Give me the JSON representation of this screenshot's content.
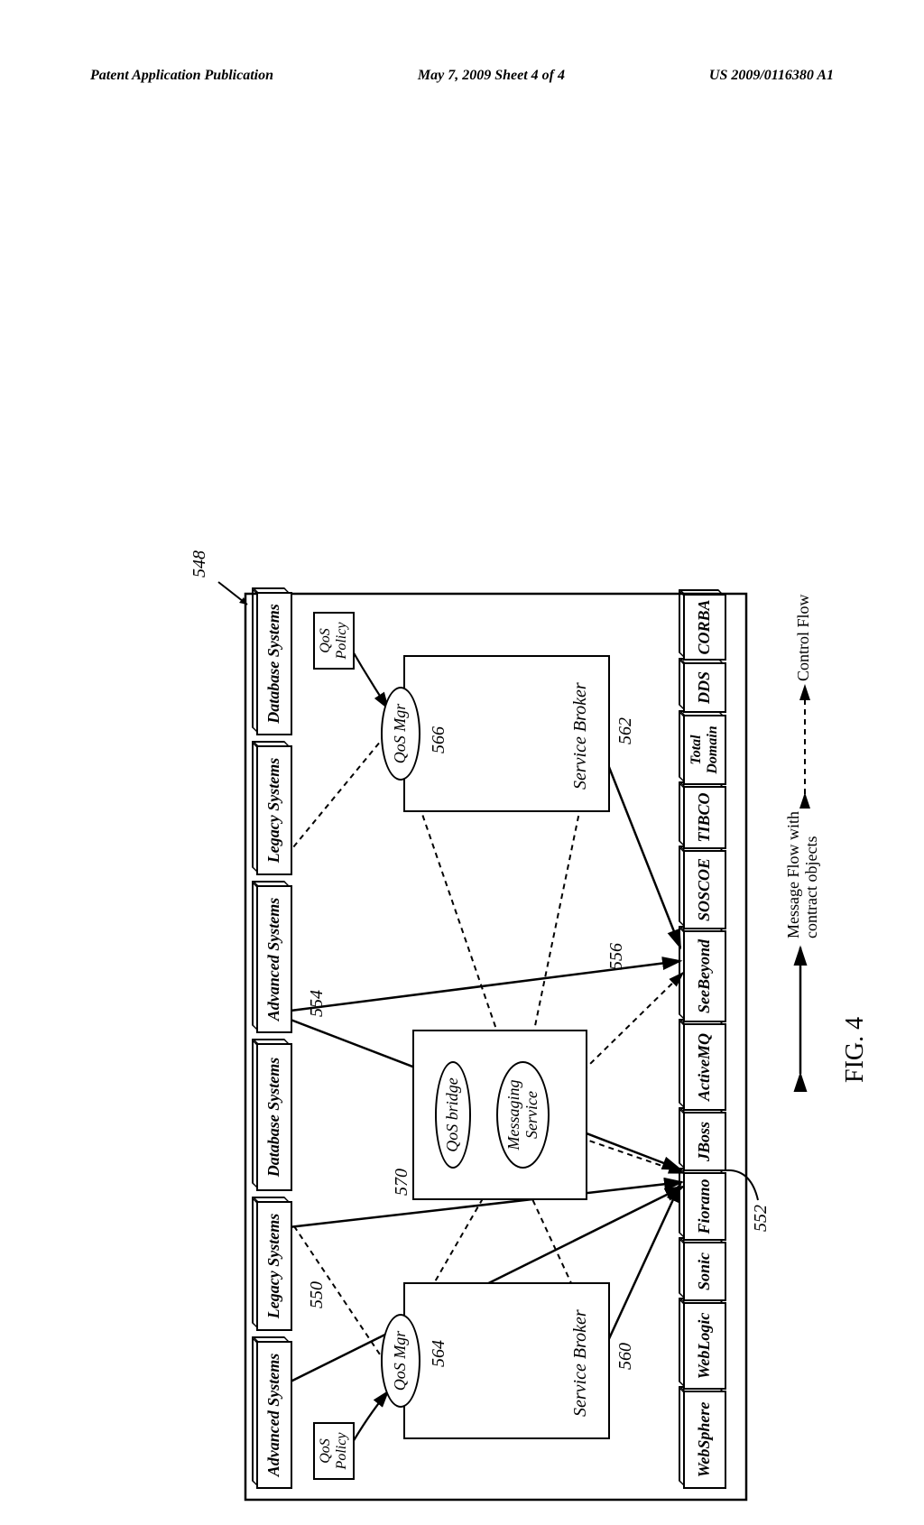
{
  "header": {
    "left": "Patent Application Publication",
    "center": "May 7, 2009   Sheet 4 of 4",
    "right": "US 2009/0116380 A1"
  },
  "figure": {
    "label": "FIG. 4",
    "mainRef": "548"
  },
  "topBoxes": {
    "adv1": "Advanced Systems",
    "leg1": "Legacy Systems",
    "db1": "Database Systems",
    "adv2": "Advanced Systems",
    "leg2": "Legacy Systems",
    "db2": "Database Systems"
  },
  "brokers": {
    "sb1": "Service Broker",
    "sb2": "Service Broker",
    "qosMgr1": "QoS Mgr",
    "qosMgr2": "QoS Mgr",
    "qosPolicy1": "QoS\nPolicy",
    "qosPolicy2": "QoS\nPolicy",
    "qosBridge": "QoS bridge",
    "msgService": "Messaging\nService"
  },
  "bottomBoxes": {
    "websphere": "WebSphere",
    "weblogic": "WebLogic",
    "sonic": "Sonic",
    "fiorano": "Fiorano",
    "jboss": "JBoss",
    "activemq": "ActiveMQ",
    "seebeyond": "SeeBeyond",
    "soscoe": "SOSCOE",
    "tibco": "TIBCO",
    "totaldomain": "Total\nDomain",
    "dds": "DDS",
    "corba": "CORBA"
  },
  "refs": {
    "r550": "550",
    "r554": "554",
    "r570": "570",
    "r564": "564",
    "r566": "566",
    "r560": "560",
    "r562": "562",
    "r556": "556",
    "r552": "552"
  },
  "legend": {
    "msgflow": "Message Flow with\ncontract objects",
    "ctrlflow": "Control Flow"
  }
}
